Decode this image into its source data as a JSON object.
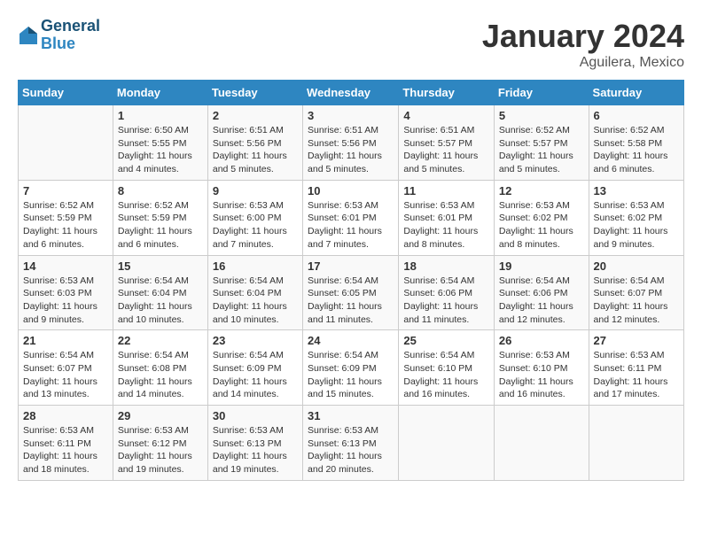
{
  "header": {
    "logo_line1": "General",
    "logo_line2": "Blue",
    "month": "January 2024",
    "location": "Aguilera, Mexico"
  },
  "days_of_week": [
    "Sunday",
    "Monday",
    "Tuesday",
    "Wednesday",
    "Thursday",
    "Friday",
    "Saturday"
  ],
  "weeks": [
    [
      {
        "day": "",
        "info": ""
      },
      {
        "day": "1",
        "info": "Sunrise: 6:50 AM\nSunset: 5:55 PM\nDaylight: 11 hours\nand 4 minutes."
      },
      {
        "day": "2",
        "info": "Sunrise: 6:51 AM\nSunset: 5:56 PM\nDaylight: 11 hours\nand 5 minutes."
      },
      {
        "day": "3",
        "info": "Sunrise: 6:51 AM\nSunset: 5:56 PM\nDaylight: 11 hours\nand 5 minutes."
      },
      {
        "day": "4",
        "info": "Sunrise: 6:51 AM\nSunset: 5:57 PM\nDaylight: 11 hours\nand 5 minutes."
      },
      {
        "day": "5",
        "info": "Sunrise: 6:52 AM\nSunset: 5:57 PM\nDaylight: 11 hours\nand 5 minutes."
      },
      {
        "day": "6",
        "info": "Sunrise: 6:52 AM\nSunset: 5:58 PM\nDaylight: 11 hours\nand 6 minutes."
      }
    ],
    [
      {
        "day": "7",
        "info": "Sunrise: 6:52 AM\nSunset: 5:59 PM\nDaylight: 11 hours\nand 6 minutes."
      },
      {
        "day": "8",
        "info": "Sunrise: 6:52 AM\nSunset: 5:59 PM\nDaylight: 11 hours\nand 6 minutes."
      },
      {
        "day": "9",
        "info": "Sunrise: 6:53 AM\nSunset: 6:00 PM\nDaylight: 11 hours\nand 7 minutes."
      },
      {
        "day": "10",
        "info": "Sunrise: 6:53 AM\nSunset: 6:01 PM\nDaylight: 11 hours\nand 7 minutes."
      },
      {
        "day": "11",
        "info": "Sunrise: 6:53 AM\nSunset: 6:01 PM\nDaylight: 11 hours\nand 8 minutes."
      },
      {
        "day": "12",
        "info": "Sunrise: 6:53 AM\nSunset: 6:02 PM\nDaylight: 11 hours\nand 8 minutes."
      },
      {
        "day": "13",
        "info": "Sunrise: 6:53 AM\nSunset: 6:02 PM\nDaylight: 11 hours\nand 9 minutes."
      }
    ],
    [
      {
        "day": "14",
        "info": "Sunrise: 6:53 AM\nSunset: 6:03 PM\nDaylight: 11 hours\nand 9 minutes."
      },
      {
        "day": "15",
        "info": "Sunrise: 6:54 AM\nSunset: 6:04 PM\nDaylight: 11 hours\nand 10 minutes."
      },
      {
        "day": "16",
        "info": "Sunrise: 6:54 AM\nSunset: 6:04 PM\nDaylight: 11 hours\nand 10 minutes."
      },
      {
        "day": "17",
        "info": "Sunrise: 6:54 AM\nSunset: 6:05 PM\nDaylight: 11 hours\nand 11 minutes."
      },
      {
        "day": "18",
        "info": "Sunrise: 6:54 AM\nSunset: 6:06 PM\nDaylight: 11 hours\nand 11 minutes."
      },
      {
        "day": "19",
        "info": "Sunrise: 6:54 AM\nSunset: 6:06 PM\nDaylight: 11 hours\nand 12 minutes."
      },
      {
        "day": "20",
        "info": "Sunrise: 6:54 AM\nSunset: 6:07 PM\nDaylight: 11 hours\nand 12 minutes."
      }
    ],
    [
      {
        "day": "21",
        "info": "Sunrise: 6:54 AM\nSunset: 6:07 PM\nDaylight: 11 hours\nand 13 minutes."
      },
      {
        "day": "22",
        "info": "Sunrise: 6:54 AM\nSunset: 6:08 PM\nDaylight: 11 hours\nand 14 minutes."
      },
      {
        "day": "23",
        "info": "Sunrise: 6:54 AM\nSunset: 6:09 PM\nDaylight: 11 hours\nand 14 minutes."
      },
      {
        "day": "24",
        "info": "Sunrise: 6:54 AM\nSunset: 6:09 PM\nDaylight: 11 hours\nand 15 minutes."
      },
      {
        "day": "25",
        "info": "Sunrise: 6:54 AM\nSunset: 6:10 PM\nDaylight: 11 hours\nand 16 minutes."
      },
      {
        "day": "26",
        "info": "Sunrise: 6:53 AM\nSunset: 6:10 PM\nDaylight: 11 hours\nand 16 minutes."
      },
      {
        "day": "27",
        "info": "Sunrise: 6:53 AM\nSunset: 6:11 PM\nDaylight: 11 hours\nand 17 minutes."
      }
    ],
    [
      {
        "day": "28",
        "info": "Sunrise: 6:53 AM\nSunset: 6:11 PM\nDaylight: 11 hours\nand 18 minutes."
      },
      {
        "day": "29",
        "info": "Sunrise: 6:53 AM\nSunset: 6:12 PM\nDaylight: 11 hours\nand 19 minutes."
      },
      {
        "day": "30",
        "info": "Sunrise: 6:53 AM\nSunset: 6:13 PM\nDaylight: 11 hours\nand 19 minutes."
      },
      {
        "day": "31",
        "info": "Sunrise: 6:53 AM\nSunset: 6:13 PM\nDaylight: 11 hours\nand 20 minutes."
      },
      {
        "day": "",
        "info": ""
      },
      {
        "day": "",
        "info": ""
      },
      {
        "day": "",
        "info": ""
      }
    ]
  ]
}
